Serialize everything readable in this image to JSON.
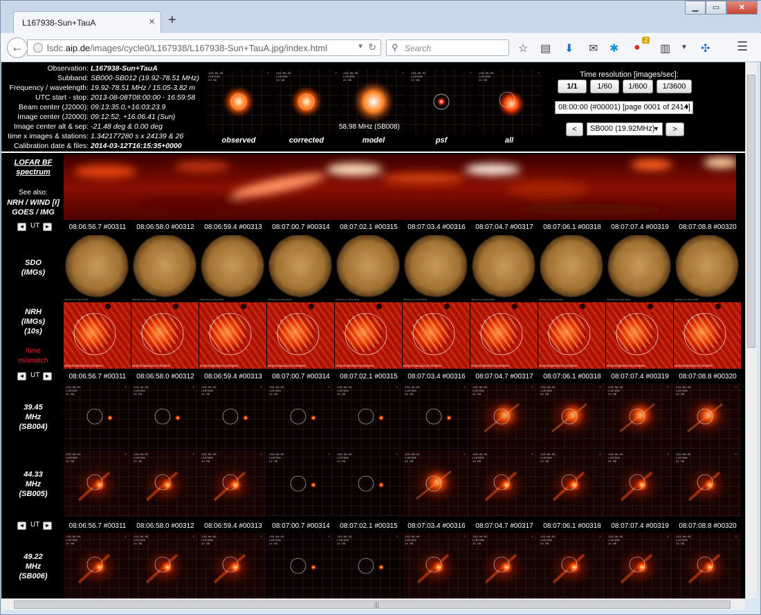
{
  "browser": {
    "tab_title": "L167938-Sun+TauA",
    "url_prefix": "lsdc.",
    "url_domain": "aip.de",
    "url_path": "/images/cycle0/L167938/L167938-Sun+TauA.jpg/index.html",
    "search_placeholder": "Search",
    "badge_count": "2"
  },
  "observation": [
    {
      "label": "Observation:",
      "value": "L167938-Sun+TauA",
      "bold": true
    },
    {
      "label": "Subband:",
      "value": "SB000-SB012 (19.92-78.51 MHz)"
    },
    {
      "label": "Frequency / wavelength:",
      "value": "19.92-78.51 MHz / 15.05-3.82 m"
    },
    {
      "label": "UTC start - stop:",
      "value": "2013-08-08T08:00:00 - 16:59:58"
    },
    {
      "label": "Beam center (J2000):",
      "value": "09:13:35.0,+16:03:23.9"
    },
    {
      "label": "Image center (J2000):",
      "value": "09:12:52, +16.06.41 (Sun)"
    },
    {
      "label": "Image center alt & sep:",
      "value": "-21.48 deg & 0.00 deg"
    },
    {
      "label": "time x images & stations:",
      "value": "1.342177280 s x 24139 & 26"
    },
    {
      "label": "Calibration date & files:",
      "value": "2014-03-12T16:15:35+0000",
      "bold": true
    }
  ],
  "thumbnails": [
    {
      "label": "observed"
    },
    {
      "label": "corrected"
    },
    {
      "label": "model",
      "note": "58.98 MHz (SB008)"
    },
    {
      "label": "psf"
    },
    {
      "label": "all"
    }
  ],
  "time_resolution": {
    "title": "Time resolution [images/sec]:",
    "buttons": [
      "1/1",
      "1/60",
      "1/600",
      "1/3600"
    ],
    "page_select": "08:00:00 (#00001) [page 0001 of 2414]",
    "prev": "<",
    "next": ">",
    "subband_select": "SB000 (19.92MHz)"
  },
  "spectrum": {
    "title_line1": "LOFAR BF",
    "title_line2": "spectrum",
    "see_also": "See also:",
    "links_line1": "NRH / WIND [I]",
    "links_line2": "GOES / IMG"
  },
  "timestamps": [
    "08:06:56.7 #00311",
    "08:06:58.0 #00312",
    "08:06:59.4 #00313",
    "08:07:00.7 #00314",
    "08:07:02.1 #00315",
    "08:07:03.4 #00316",
    "08:07:04.7 #00317",
    "08:07:06.1 #00318",
    "08:07:07.4 #00319",
    "08:07:08.8 #00320"
  ],
  "nav": {
    "left": "◄",
    "ut": "UT",
    "right": "►"
  },
  "sdo": {
    "line1": "SDO",
    "line2": "(IMGs)"
  },
  "nrh": {
    "line1": "NRH",
    "line2": "(IMGs)",
    "line3": "(10s)",
    "warn1": "!time",
    "warn2": "mismatch",
    "stamp": "08:26:59 08AUG2013 150.9MHz"
  },
  "bands": [
    {
      "freq": "39.45",
      "unit": "MHz",
      "sb": "(SB004)"
    },
    {
      "freq": "44.33",
      "unit": "MHz",
      "sb": "(SB005)"
    },
    {
      "freq": "49.22",
      "unit": "MHz",
      "sb": "(SB006)"
    }
  ],
  "colors": {
    "accent_red": "#ff2a00",
    "warning": "#ff2020",
    "background": "#000000"
  }
}
